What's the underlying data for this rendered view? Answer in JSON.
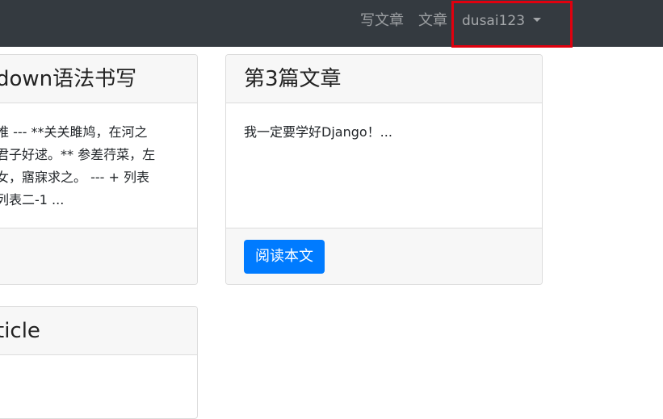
{
  "navbar": {
    "write_article": "写文章",
    "articles": "文章",
    "username": "dusai123"
  },
  "cards": [
    {
      "title": "down语法书写",
      "excerpt": "推 --- **关关雎鸠，在河之\n君子好逑。** 参差荇菜，左\n女，寤寐求之。 --- + 列表\n列表二-1 ..."
    },
    {
      "title": "第3篇文章",
      "excerpt": "我一定要学好Django！...",
      "read_label": "阅读本文"
    },
    {
      "title": "ticle",
      "excerpt": "."
    }
  ],
  "colors": {
    "navbar_bg": "#343a40",
    "primary": "#007bff",
    "highlight": "#e0000e"
  }
}
